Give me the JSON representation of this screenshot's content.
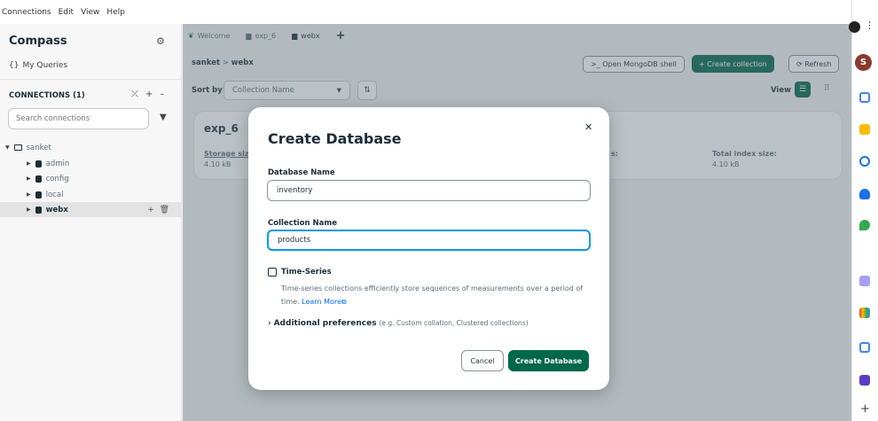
{
  "menu": [
    "Connections",
    "Edit",
    "View",
    "Help"
  ],
  "sidebar": {
    "brand": "Compass",
    "my_queries": "My Queries",
    "connections_header": "CONNECTIONS (1)",
    "search_placeholder": "Search connections",
    "tree": [
      {
        "label": "sanket"
      },
      {
        "label": "admin"
      },
      {
        "label": "config"
      },
      {
        "label": "local"
      },
      {
        "label": "webx"
      }
    ]
  },
  "tabs": [
    {
      "label": "Welcome"
    },
    {
      "label": "exp_6"
    },
    {
      "label": "webx"
    }
  ],
  "breadcrumb": {
    "connection": "sanket",
    "sep": ">",
    "db": "webx"
  },
  "toolbar": {
    "shell": ">_ Open MongoDB shell",
    "create_collection": "+ Create collection",
    "refresh": "Refresh"
  },
  "sort": {
    "label": "Sort by",
    "value": "Collection Name"
  },
  "view_label": "View",
  "card": {
    "title": "exp_6",
    "storage_label": "Storage size",
    "storage_value": "4.10 kB",
    "index_label": "Total index size:",
    "index_value": "4.10 kB",
    "mid_label": "s:"
  },
  "modal": {
    "title": "Create Database",
    "db_label": "Database Name",
    "db_value": "inventory",
    "coll_label": "Collection Name",
    "coll_value": "products",
    "ts_label": "Time-Series",
    "ts_desc": "Time-series collections efficiently store sequences of measurements over a period of time.",
    "learn_more": "Learn More",
    "adv_label": "Additional preferences",
    "adv_hint": "(e.g. Custom collation, Clustered collections)",
    "cancel": "Cancel",
    "create": "Create Database"
  },
  "profile_initial": "S",
  "colors": {
    "primary_green": "#00684a",
    "focus_blue": "#0498ec",
    "link_blue": "#016bf8",
    "text_dark": "#1c2d38"
  }
}
